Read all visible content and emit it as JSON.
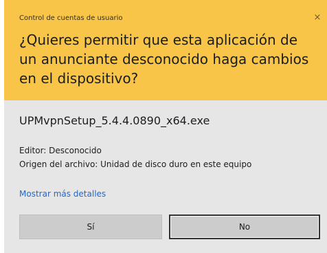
{
  "dialog": {
    "caption": "Control de cuentas de usuario",
    "close_glyph": "×",
    "question": "¿Quieres permitir que esta aplicación de un anunciante desconocido haga cambios en el dispositivo?",
    "program_name": "UPMvpnSetup_5.4.4.0890_x64.exe",
    "publisher": "Editor: Desconocido",
    "origin": "Origen del archivo: Unidad de disco duro en este equipo",
    "details_link": "Mostrar más detalles",
    "yes_label": "Sí",
    "no_label": "No"
  },
  "colors": {
    "header": "#f8c548",
    "body": "#e6e6e6",
    "link": "#1f68c9",
    "button": "#cccccc"
  }
}
